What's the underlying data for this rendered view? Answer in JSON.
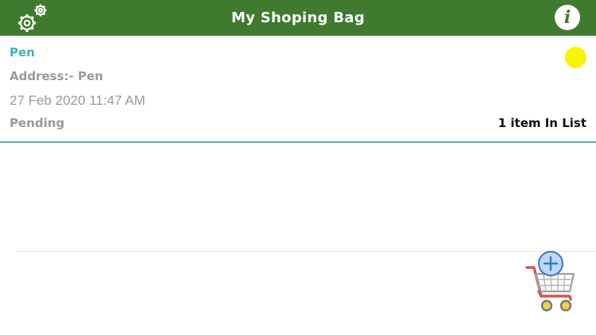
{
  "header": {
    "title": "My Shoping Bag",
    "left_icon": "settings-gears-icon",
    "right_icon": "info-icon",
    "info_glyph": "i",
    "bar_color": "#3f7a2e"
  },
  "lists": [
    {
      "name": "Pen",
      "address": "Address:- Pen",
      "date": "27 Feb 2020 11:47 AM",
      "status": "Pending",
      "item_count": "1 item In List",
      "status_color": "#f7f500"
    }
  ],
  "fab": {
    "icon": "add-to-cart-icon"
  }
}
